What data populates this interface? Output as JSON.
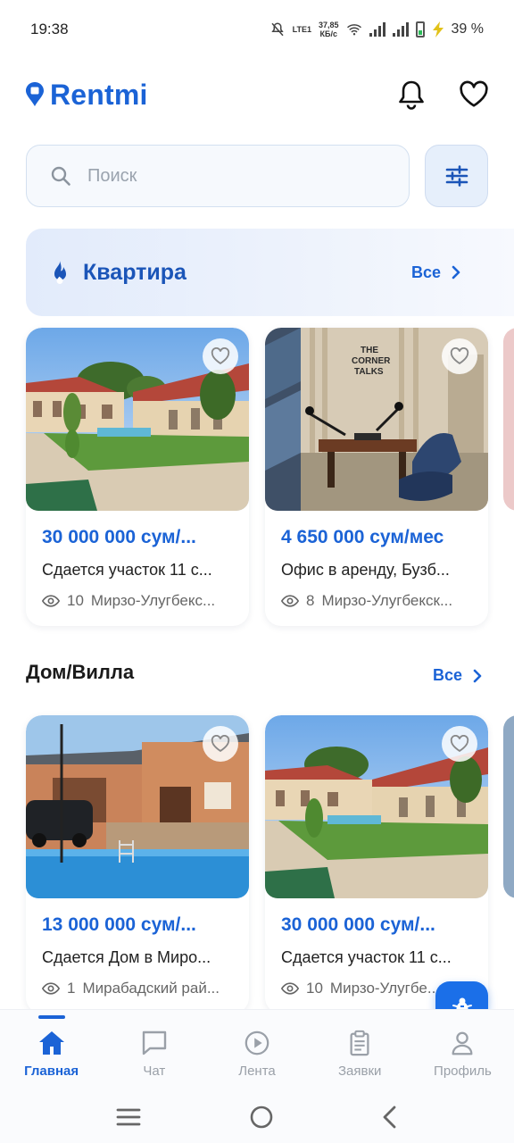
{
  "status_bar": {
    "time": "19:38",
    "net_speed_top": "37,85",
    "net_speed_bottom": "КБ/с",
    "lte": "LTE1",
    "battery": "39 %"
  },
  "header": {
    "brand": "Rentmi"
  },
  "search": {
    "placeholder": "Поиск"
  },
  "categories": [
    {
      "title": "Квартира",
      "see_all": "Все",
      "cards": [
        {
          "price": "30 000 000 сум/...",
          "description": "Сдается участок  11 с...",
          "views": "10",
          "location": "Мирзо-Улугбекс..."
        },
        {
          "price": "4 650 000 сум/мес",
          "description": "Офис в аренду, Бузб...",
          "views": "8",
          "location": "Мирзо-Улугбекск..."
        }
      ]
    },
    {
      "title": "Дом/Вилла",
      "see_all": "Все",
      "cards": [
        {
          "price": "13 000 000 сум/...",
          "description": "Сдается Дом в Миро...",
          "views": "1",
          "location": "Мирабадский рай..."
        },
        {
          "price": "30 000 000 сум/...",
          "description": "Сдается участок  11 с...",
          "views": "10",
          "location": "Мирзо-Улугбе..."
        }
      ]
    }
  ],
  "photo_signs": {
    "podcast_line1": "THE",
    "podcast_line2": "CORNER",
    "podcast_line3": "TALKS"
  },
  "bottom_nav": {
    "items": [
      {
        "label": "Главная",
        "icon": "home-icon",
        "active": true
      },
      {
        "label": "Чат",
        "icon": "chat-icon"
      },
      {
        "label": "Лента",
        "icon": "play-icon"
      },
      {
        "label": "Заявки",
        "icon": "clipboard-icon"
      },
      {
        "label": "Профиль",
        "icon": "user-icon"
      }
    ]
  },
  "colors": {
    "brand": "#1b63d6",
    "accent_button": "#1b6fe8"
  }
}
